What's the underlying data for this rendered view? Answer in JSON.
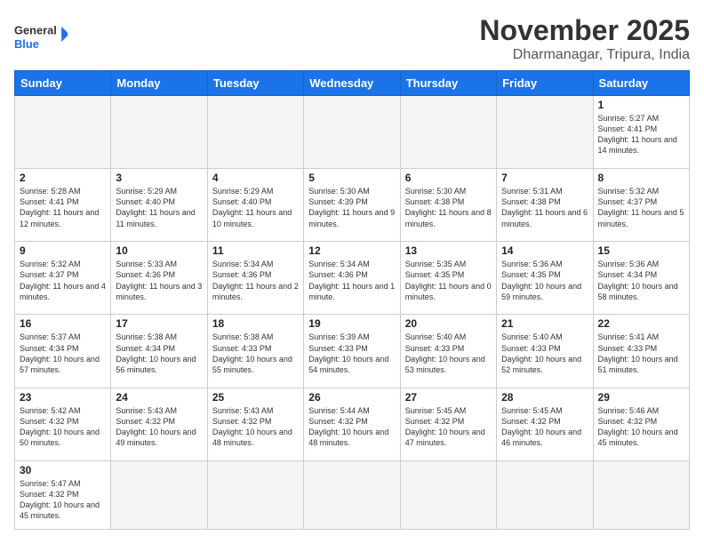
{
  "logo": {
    "text_general": "General",
    "text_blue": "Blue"
  },
  "header": {
    "month": "November 2025",
    "location": "Dharmanagar, Tripura, India"
  },
  "days_of_week": [
    "Sunday",
    "Monday",
    "Tuesday",
    "Wednesday",
    "Thursday",
    "Friday",
    "Saturday"
  ],
  "weeks": [
    [
      {
        "day": "",
        "info": ""
      },
      {
        "day": "",
        "info": ""
      },
      {
        "day": "",
        "info": ""
      },
      {
        "day": "",
        "info": ""
      },
      {
        "day": "",
        "info": ""
      },
      {
        "day": "",
        "info": ""
      },
      {
        "day": "1",
        "info": "Sunrise: 5:27 AM\nSunset: 4:41 PM\nDaylight: 11 hours\nand 14 minutes."
      }
    ],
    [
      {
        "day": "2",
        "info": "Sunrise: 5:28 AM\nSunset: 4:41 PM\nDaylight: 11 hours\nand 12 minutes."
      },
      {
        "day": "3",
        "info": "Sunrise: 5:29 AM\nSunset: 4:40 PM\nDaylight: 11 hours\nand 11 minutes."
      },
      {
        "day": "4",
        "info": "Sunrise: 5:29 AM\nSunset: 4:40 PM\nDaylight: 11 hours\nand 10 minutes."
      },
      {
        "day": "5",
        "info": "Sunrise: 5:30 AM\nSunset: 4:39 PM\nDaylight: 11 hours\nand 9 minutes."
      },
      {
        "day": "6",
        "info": "Sunrise: 5:30 AM\nSunset: 4:38 PM\nDaylight: 11 hours\nand 8 minutes."
      },
      {
        "day": "7",
        "info": "Sunrise: 5:31 AM\nSunset: 4:38 PM\nDaylight: 11 hours\nand 6 minutes."
      },
      {
        "day": "8",
        "info": "Sunrise: 5:32 AM\nSunset: 4:37 PM\nDaylight: 11 hours\nand 5 minutes."
      }
    ],
    [
      {
        "day": "9",
        "info": "Sunrise: 5:32 AM\nSunset: 4:37 PM\nDaylight: 11 hours\nand 4 minutes."
      },
      {
        "day": "10",
        "info": "Sunrise: 5:33 AM\nSunset: 4:36 PM\nDaylight: 11 hours\nand 3 minutes."
      },
      {
        "day": "11",
        "info": "Sunrise: 5:34 AM\nSunset: 4:36 PM\nDaylight: 11 hours\nand 2 minutes."
      },
      {
        "day": "12",
        "info": "Sunrise: 5:34 AM\nSunset: 4:36 PM\nDaylight: 11 hours\nand 1 minute."
      },
      {
        "day": "13",
        "info": "Sunrise: 5:35 AM\nSunset: 4:35 PM\nDaylight: 11 hours\nand 0 minutes."
      },
      {
        "day": "14",
        "info": "Sunrise: 5:36 AM\nSunset: 4:35 PM\nDaylight: 10 hours\nand 59 minutes."
      },
      {
        "day": "15",
        "info": "Sunrise: 5:36 AM\nSunset: 4:34 PM\nDaylight: 10 hours\nand 58 minutes."
      }
    ],
    [
      {
        "day": "16",
        "info": "Sunrise: 5:37 AM\nSunset: 4:34 PM\nDaylight: 10 hours\nand 57 minutes."
      },
      {
        "day": "17",
        "info": "Sunrise: 5:38 AM\nSunset: 4:34 PM\nDaylight: 10 hours\nand 56 minutes."
      },
      {
        "day": "18",
        "info": "Sunrise: 5:38 AM\nSunset: 4:33 PM\nDaylight: 10 hours\nand 55 minutes."
      },
      {
        "day": "19",
        "info": "Sunrise: 5:39 AM\nSunset: 4:33 PM\nDaylight: 10 hours\nand 54 minutes."
      },
      {
        "day": "20",
        "info": "Sunrise: 5:40 AM\nSunset: 4:33 PM\nDaylight: 10 hours\nand 53 minutes."
      },
      {
        "day": "21",
        "info": "Sunrise: 5:40 AM\nSunset: 4:33 PM\nDaylight: 10 hours\nand 52 minutes."
      },
      {
        "day": "22",
        "info": "Sunrise: 5:41 AM\nSunset: 4:33 PM\nDaylight: 10 hours\nand 51 minutes."
      }
    ],
    [
      {
        "day": "23",
        "info": "Sunrise: 5:42 AM\nSunset: 4:32 PM\nDaylight: 10 hours\nand 50 minutes."
      },
      {
        "day": "24",
        "info": "Sunrise: 5:43 AM\nSunset: 4:32 PM\nDaylight: 10 hours\nand 49 minutes."
      },
      {
        "day": "25",
        "info": "Sunrise: 5:43 AM\nSunset: 4:32 PM\nDaylight: 10 hours\nand 48 minutes."
      },
      {
        "day": "26",
        "info": "Sunrise: 5:44 AM\nSunset: 4:32 PM\nDaylight: 10 hours\nand 48 minutes."
      },
      {
        "day": "27",
        "info": "Sunrise: 5:45 AM\nSunset: 4:32 PM\nDaylight: 10 hours\nand 47 minutes."
      },
      {
        "day": "28",
        "info": "Sunrise: 5:45 AM\nSunset: 4:32 PM\nDaylight: 10 hours\nand 46 minutes."
      },
      {
        "day": "29",
        "info": "Sunrise: 5:46 AM\nSunset: 4:32 PM\nDaylight: 10 hours\nand 45 minutes."
      }
    ],
    [
      {
        "day": "30",
        "info": "Sunrise: 5:47 AM\nSunset: 4:32 PM\nDaylight: 10 hours\nand 45 minutes."
      },
      {
        "day": "",
        "info": ""
      },
      {
        "day": "",
        "info": ""
      },
      {
        "day": "",
        "info": ""
      },
      {
        "day": "",
        "info": ""
      },
      {
        "day": "",
        "info": ""
      },
      {
        "day": "",
        "info": ""
      }
    ]
  ]
}
